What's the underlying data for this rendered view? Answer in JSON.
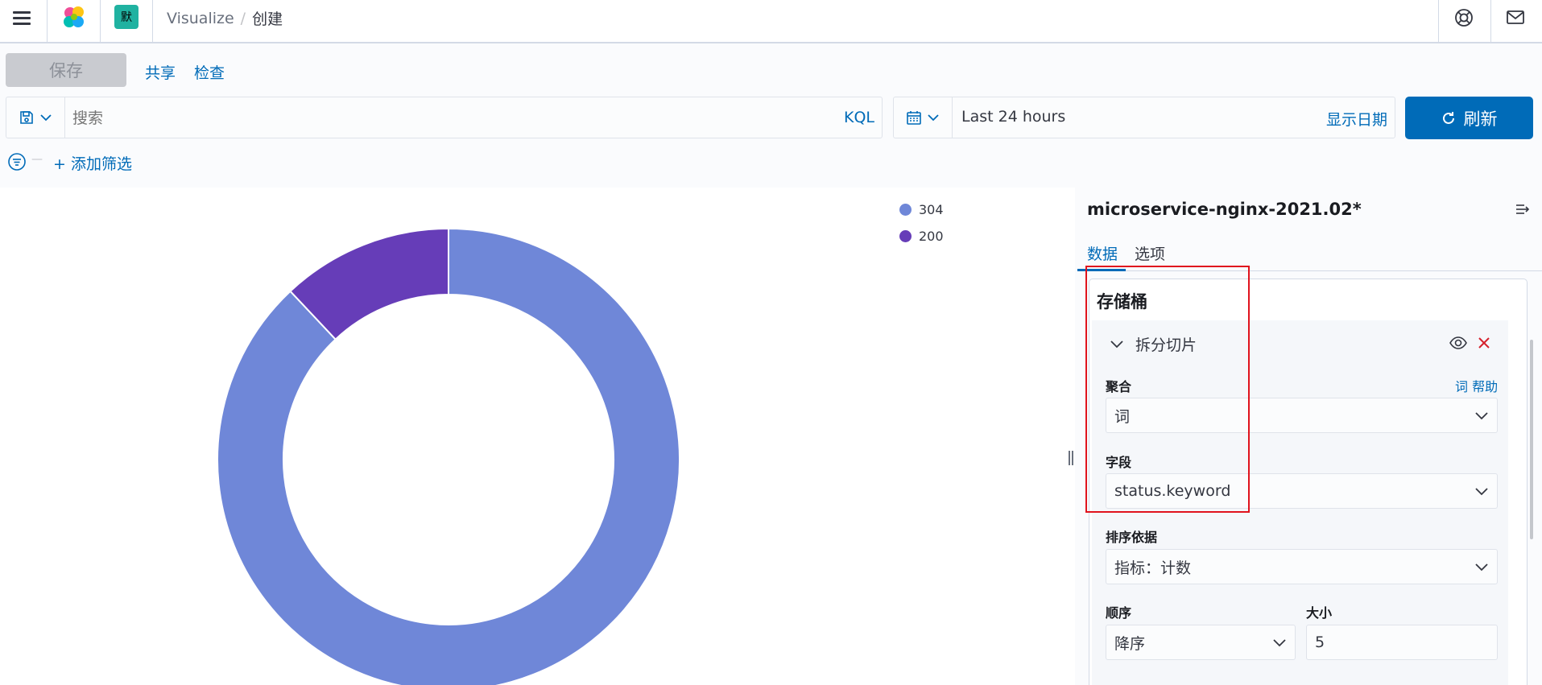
{
  "header": {
    "space_initial": "默",
    "breadcrumbs": [
      "Visualize",
      "创建"
    ],
    "breadcrumb_sep": "/"
  },
  "toolbar": {
    "save_label": "保存",
    "share_label": "共享",
    "inspect_label": "检查"
  },
  "query": {
    "search_placeholder": "搜索",
    "language": "KQL",
    "time_range": "Last 24 hours",
    "show_dates_label": "显示日期",
    "refresh_label": "刷新",
    "add_filter_label": "+ 添加筛选",
    "filter_dash": "—"
  },
  "chart_data": {
    "type": "pie",
    "donut": true,
    "slices": [
      {
        "label": "304",
        "value": 88,
        "color": "#6f87d8"
      },
      {
        "label": "200",
        "value": 12,
        "color": "#663db8"
      }
    ],
    "legend": {
      "position": "top-right",
      "items": [
        "304",
        "200"
      ]
    }
  },
  "sidebar": {
    "index_title": "microservice-nginx-2021.02*",
    "tabs": [
      "数据",
      "选项"
    ],
    "active_tab": "数据",
    "section_title": "存储桶",
    "agg_title": "拆分切片",
    "aggregation_label": "聚合",
    "aggregation_help": "词 帮助",
    "aggregation_value": "词",
    "field_label": "字段",
    "field_value": "status.keyword",
    "order_by_label": "排序依据",
    "order_by_value": "指标：计数",
    "order_label": "顺序",
    "order_value": "降序",
    "size_label": "大小",
    "size_value": "5"
  },
  "colors": {
    "primary": "#006bb8",
    "slice_304": "#6f87d8",
    "slice_200": "#663db8",
    "highlight": "#e0131d"
  }
}
